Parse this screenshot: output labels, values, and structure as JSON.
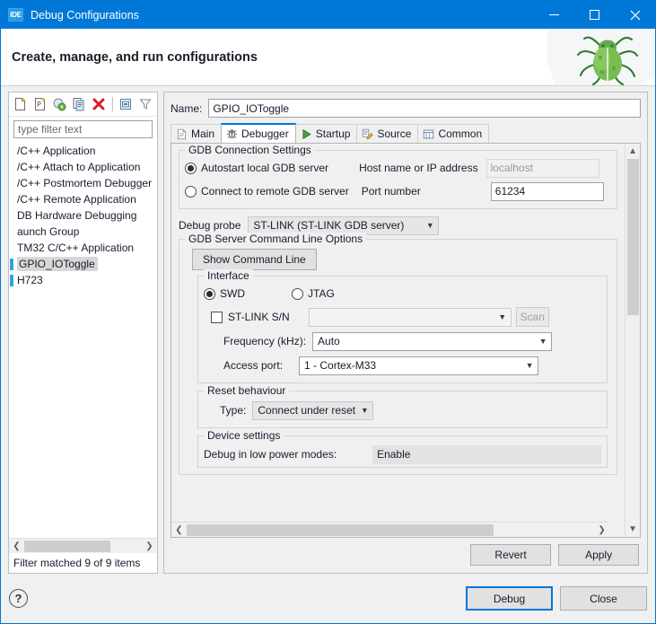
{
  "window": {
    "title": "Debug Configurations",
    "icon": "IDE",
    "minimize_label": "Minimize",
    "maximize_label": "Maximize",
    "close_label": "Close"
  },
  "banner": {
    "heading": "Create, manage, and run configurations",
    "art": "bug-icon"
  },
  "tree_panel": {
    "toolbar": [
      {
        "name": "new-launch-configuration-icon",
        "tooltip": "New launch configuration"
      },
      {
        "name": "new-prototype-icon",
        "tooltip": "New prototype"
      },
      {
        "name": "new-launch-group-icon",
        "tooltip": "New launch group"
      },
      {
        "name": "duplicate-icon",
        "tooltip": "Duplicate"
      },
      {
        "name": "delete-icon",
        "tooltip": "Delete"
      },
      {
        "name": "collapse-all-icon",
        "tooltip": "Collapse All"
      },
      {
        "name": "filter-icon",
        "tooltip": "Filter launch configurations"
      }
    ],
    "filter_placeholder": "type filter text",
    "items": [
      {
        "label": "/C++ Application",
        "leaf": false,
        "selected": false
      },
      {
        "label": "/C++ Attach to Application",
        "leaf": false,
        "selected": false
      },
      {
        "label": "/C++ Postmortem Debugger",
        "leaf": false,
        "selected": false
      },
      {
        "label": "/C++ Remote Application",
        "leaf": false,
        "selected": false
      },
      {
        "label": "DB Hardware Debugging",
        "leaf": false,
        "selected": false
      },
      {
        "label": "aunch Group",
        "leaf": false,
        "selected": false
      },
      {
        "label": "TM32 C/C++ Application",
        "leaf": false,
        "selected": false
      },
      {
        "label": "GPIO_IOToggle",
        "leaf": true,
        "selected": true
      },
      {
        "label": "H723",
        "leaf": true,
        "selected": false
      }
    ],
    "status": "Filter matched 9 of 9 items"
  },
  "config": {
    "name_label": "Name:",
    "name_value": "GPIO_IOToggle",
    "tabs": [
      {
        "label": "Main",
        "icon": "document-icon",
        "active": false
      },
      {
        "label": "Debugger",
        "icon": "bug-icon",
        "active": true
      },
      {
        "label": "Startup",
        "icon": "play-icon",
        "active": false
      },
      {
        "label": "Source",
        "icon": "source-icon",
        "active": false
      },
      {
        "label": "Common",
        "icon": "table-icon",
        "active": false
      }
    ],
    "gdb_connection": {
      "group_label": "GDB Connection Settings",
      "autostart_label": "Autostart local GDB server",
      "autostart_selected": true,
      "remote_label": "Connect to remote GDB server",
      "remote_selected": false,
      "host_label": "Host name or IP address",
      "host_value": "localhost",
      "host_disabled": true,
      "port_label": "Port number",
      "port_value": "61234"
    },
    "debug_probe": {
      "label": "Debug probe",
      "value": "ST-LINK (ST-LINK GDB server)"
    },
    "server_options": {
      "group_label": "GDB Server Command Line Options",
      "show_command_line_label": "Show Command Line",
      "interface": {
        "group_label": "Interface",
        "swd_label": "SWD",
        "swd_selected": true,
        "jtag_label": "JTAG",
        "jtag_selected": false,
        "serial_number_label": "ST-LINK S/N",
        "serial_number_checked": false,
        "serial_number_value": "",
        "scan_label": "Scan",
        "scan_disabled": true,
        "frequency_label": "Frequency (kHz):",
        "frequency_value": "Auto",
        "access_port_label": "Access port:",
        "access_port_value": "1 - Cortex-M33"
      },
      "reset_behaviour": {
        "group_label": "Reset behaviour",
        "type_label": "Type:",
        "type_value": "Connect under reset"
      },
      "device_settings": {
        "group_label": "Device settings",
        "low_power_label": "Debug in low power modes:",
        "low_power_value": "Enable"
      }
    },
    "revert_label": "Revert",
    "apply_label": "Apply"
  },
  "footer": {
    "help_label": "?",
    "debug_label": "Debug",
    "close_label": "Close"
  },
  "colors": {
    "accent": "#0078d7",
    "title_bar": "#0078d7",
    "dialog_bg": "#f0f0f0",
    "selection": "#d8d8d8",
    "scrollbar_thumb": "#cdcdcd"
  }
}
